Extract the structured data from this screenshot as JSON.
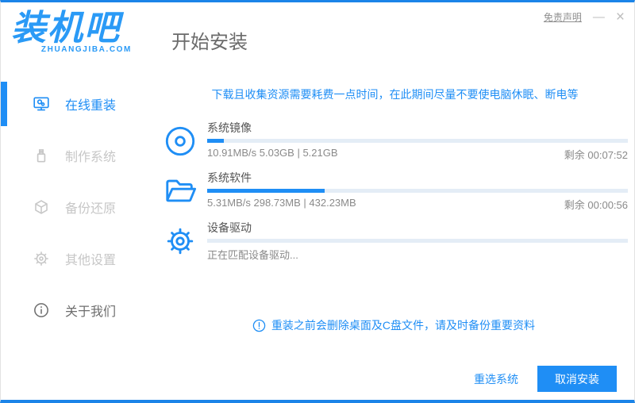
{
  "window": {
    "disclaimer": "免责声明",
    "minimize_label": "—",
    "close_label": "×"
  },
  "brand": {
    "logo_text": "装机吧",
    "logo_domain": "ZHUANGJIBA.COM"
  },
  "header": {
    "title": "开始安装"
  },
  "sidebar": {
    "items": [
      {
        "label": "在线重装",
        "icon": "monitor-reinstall-icon",
        "active": true
      },
      {
        "label": "制作系统",
        "icon": "usb-icon",
        "active": false
      },
      {
        "label": "备份还原",
        "icon": "backup-restore-icon",
        "active": false
      },
      {
        "label": "其他设置",
        "icon": "gear-icon",
        "active": false
      },
      {
        "label": "关于我们",
        "icon": "info-icon",
        "active": false
      }
    ]
  },
  "main": {
    "warning": "下载且收集资源需要耗费一点时间，在此期间尽量不要使电脑休眠、断电等",
    "tasks": [
      {
        "name": "系统镜像",
        "icon": "disc-icon",
        "progress_percent": 4,
        "status_left": "10.91MB/s 5.03GB | 5.21GB",
        "status_right": "剩余 00:07:52"
      },
      {
        "name": "系统软件",
        "icon": "folder-icon",
        "progress_percent": 28,
        "status_left": "5.31MB/s 298.73MB | 432.23MB",
        "status_right": "剩余 00:00:56"
      },
      {
        "name": "设备驱动",
        "icon": "gear-icon",
        "progress_percent": 0,
        "status_left": "正在匹配设备驱动...",
        "status_right": ""
      }
    ],
    "notice": "重装之前会删除桌面及C盘文件，请及时备份重要资料"
  },
  "footer": {
    "reselect_label": "重选系统",
    "cancel_label": "取消安装"
  },
  "colors": {
    "primary": "#1f8ef5",
    "border_blue": "#1b84e8",
    "progress_track": "#e4edf6",
    "inactive_gray": "#c7c7c7"
  }
}
